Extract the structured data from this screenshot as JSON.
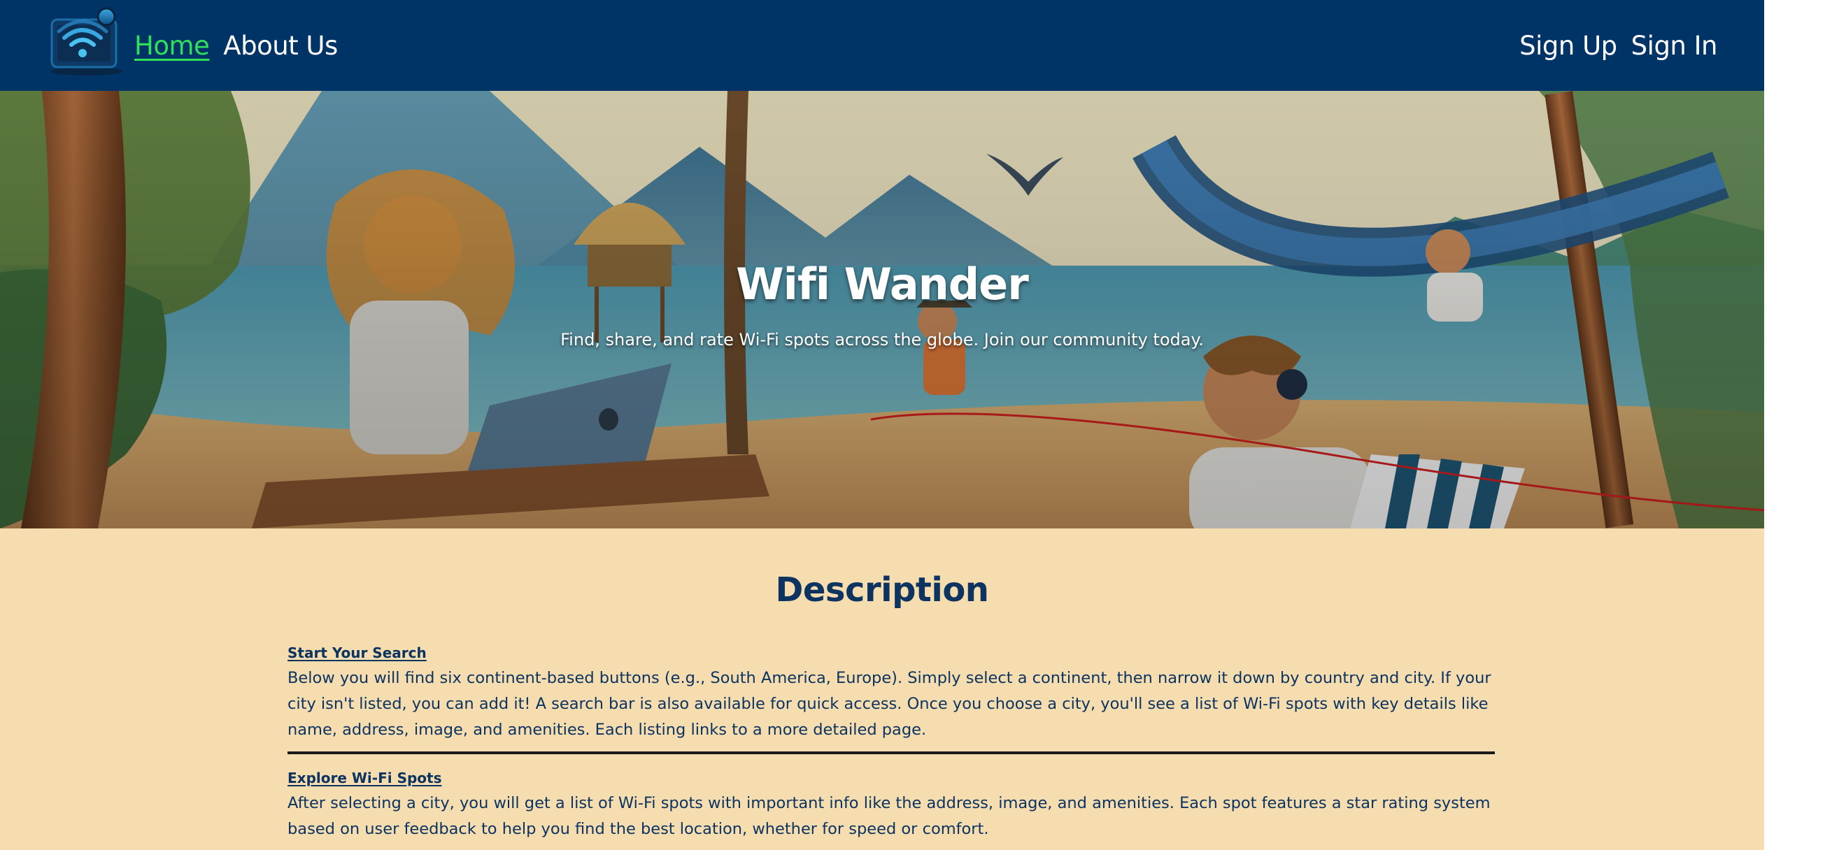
{
  "navbar": {
    "logo_icon": "wifi-laptop-logo-icon",
    "links_left": [
      {
        "label": "Home",
        "active": true
      },
      {
        "label": "About Us",
        "active": false
      }
    ],
    "links_right": [
      {
        "label": "Sign Up"
      },
      {
        "label": "Sign In"
      }
    ],
    "colors": {
      "background": "#003366",
      "active_link": "#2fe05a",
      "link": "#ffffff"
    }
  },
  "hero": {
    "title": "Wifi Wander",
    "subtitle": "Find, share, and rate Wi-Fi spots across the globe. Join our community today."
  },
  "description": {
    "heading": "Description",
    "items": [
      {
        "title": "Start Your Search",
        "text": "Below you will find six continent-based buttons (e.g., South America, Europe). Simply select a continent, then narrow it down by country and city. If your city isn't listed, you can add it! A search bar is also available for quick access. Once you choose a city, you'll see a list of Wi-Fi spots with key details like name, address, image, and amenities. Each listing links to a more detailed page."
      },
      {
        "title": "Explore Wi-Fi Spots",
        "text": "After selecting a city, you will get a list of Wi-Fi spots with important info like the address, image, and amenities. Each spot features a star rating system based on user feedback to help you find the best location, whether for speed or comfort."
      }
    ],
    "colors": {
      "background": "#f5ddb0",
      "text": "#0d3360"
    }
  }
}
